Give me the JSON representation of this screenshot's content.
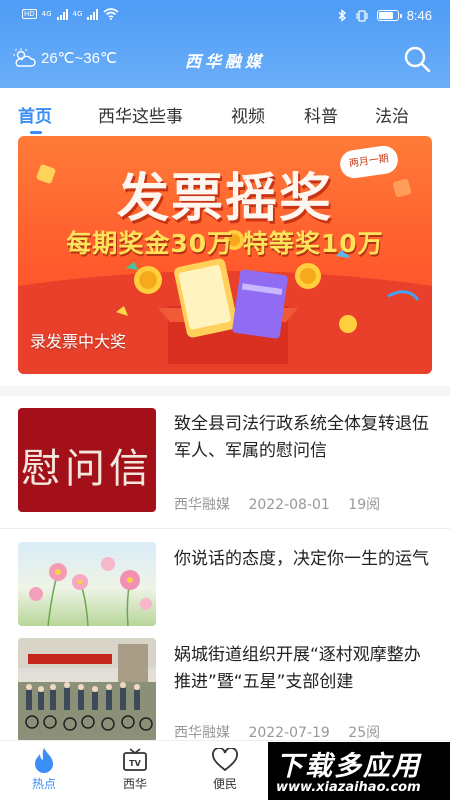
{
  "status_bar": {
    "left_labels": [
      "HD",
      "4G",
      "4G"
    ],
    "time": "8:46"
  },
  "header": {
    "weather": "26℃~36℃",
    "title": "西华融媒"
  },
  "tabs": [
    {
      "label": "首页",
      "active": true
    },
    {
      "label": "西华这些事",
      "active": false
    },
    {
      "label": "视频",
      "active": false
    },
    {
      "label": "科普",
      "active": false
    },
    {
      "label": "法治",
      "active": false
    }
  ],
  "banner": {
    "headline": "发票摇奖",
    "badge": "两月一期",
    "subline": "每期奖金30万 特等奖10万",
    "caption": "录发票中大奖"
  },
  "news": [
    {
      "title": "致全县司法行政系统全体复转退伍军人、军属的慰问信",
      "thumb_text": "慰问信",
      "source": "西华融媒",
      "date": "2022-08-01",
      "reads": "19阅"
    },
    {
      "title": "你说话的态度，决定你一生的运气",
      "source": "",
      "date": "",
      "reads": ""
    },
    {
      "title": "娲城街道组织开展“逐村观摩整办 推进”暨“五星”支部创建",
      "source": "西华融媒",
      "date": "2022-07-19",
      "reads": "25阅"
    }
  ],
  "bottom_nav": [
    {
      "label": "热点",
      "icon": "flame-icon",
      "active": true
    },
    {
      "label": "西华",
      "icon": "tv-icon",
      "active": false
    },
    {
      "label": "便民",
      "icon": "heart-icon",
      "active": false
    }
  ],
  "watermark": {
    "big": "下载多应用",
    "small": "www.xiazaihao.com"
  },
  "colors": {
    "accent": "#3a8ef6",
    "header": "#5aa3f7",
    "banner": "#ff6a30"
  }
}
